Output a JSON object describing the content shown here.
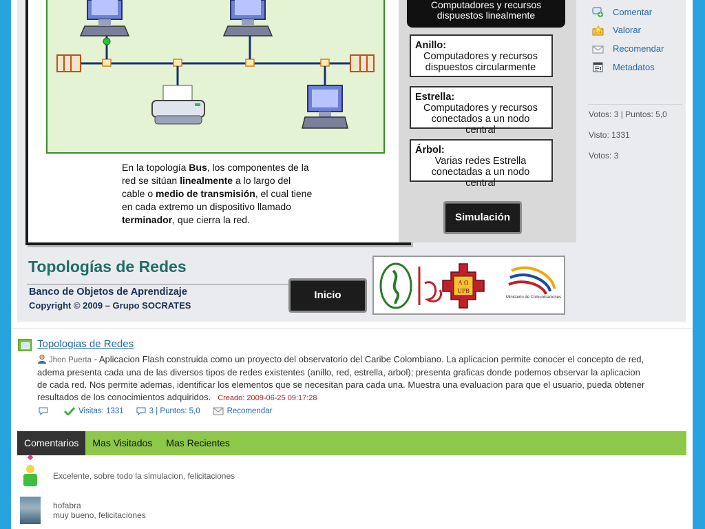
{
  "flash": {
    "top_box_lines": [
      "Computadores y recursos",
      "dispuestos linealmente"
    ],
    "topologies": [
      {
        "title": "Anillo:",
        "lines": [
          "Computadores y recursos",
          "dispuestos circularmente"
        ]
      },
      {
        "title": "Estrella:",
        "lines": [
          "Computadores y recursos",
          "conectados a un nodo central"
        ]
      },
      {
        "title": "Árbol:",
        "lines": [
          "Varias redes Estrella",
          "conectadas a un nodo central"
        ]
      }
    ],
    "description": {
      "p1": "En la topología ",
      "b1": "Bus",
      "p2": ", los componentes de la red se sitúan ",
      "b2": "linealmente",
      "p3": " a lo largo del cable o ",
      "b3": "medio de transmisión",
      "p4": ", el cual tiene en cada extremo un dispositivo llamado ",
      "b4": "terminador",
      "p5": ", que cierra la red."
    },
    "simulacion_label": "Simulación",
    "inicio_label": "Inicio",
    "banner_title": "Topologías de Redes",
    "banner_subtitle": "Banco de Objetos de Aprendizaje",
    "banner_copyright": "Copyright © 2009 – Grupo SOCRATES",
    "logo_texts": {
      "seal_letters": "Α Ω",
      "seal_abbrev": "UPB",
      "ministry": "Ministerio de Comunicaciones"
    }
  },
  "sidebar": {
    "actions": [
      {
        "label": "Comentar",
        "icon": "comment-add-icon"
      },
      {
        "label": "Valorar",
        "icon": "star-folder-icon"
      },
      {
        "label": "Recomendar",
        "icon": "envelope-icon"
      },
      {
        "label": "Metadatos",
        "icon": "metadata-icon"
      }
    ],
    "votes_points": "Votos: 3 | Puntos: 5,0",
    "visto": "Visto: 1331",
    "votos": "Votos: 3"
  },
  "item": {
    "title": "Topologias de Redes",
    "author": "Jhon Puerta",
    "description": " - Aplicacion Flash construida como un proyecto del observatorio del Caribe Colombiano. La aplicacion permite conocer el concepto de red, adema presenta cada una de las diversos tipos de redes existentes (anillo, red, estrella, arbol); presenta graficas donde podemos observar la aplicacion de cada red. Nos permite ademas, identificar los elementos que se necesitan para cada una. Muestra una evaluacion para que el usuario, pueda obtener resultados de los conocimientos adquiridos.",
    "created": "Creado: 2009-06-25 09:17:28",
    "visits": "Visitas: 1331",
    "votes_points": "3 | Puntos: 5,0",
    "recommend": "Recomendar"
  },
  "tabs": [
    "Comentarios",
    "Mas Visitados",
    "Mas Recientes"
  ],
  "comments": [
    {
      "user": "",
      "text": "Excelente, sobre todo la simulacion, felicitaciones"
    },
    {
      "user": "hofabra",
      "text": "muy bueno, felicitaciones"
    }
  ],
  "colors": {
    "accent": "#8dc84b",
    "link": "#2266aa",
    "background": "#29a3e0"
  }
}
